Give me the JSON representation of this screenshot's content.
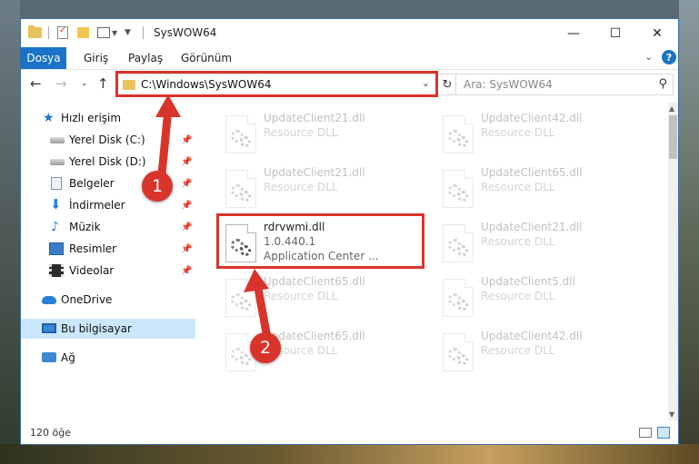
{
  "window": {
    "title": "SysWOW64",
    "controls": {
      "minimize": "—",
      "maximize": "☐",
      "close": "✕"
    }
  },
  "ribbon": {
    "tabs": [
      "Dosya",
      "Giriş",
      "Paylaş",
      "Görünüm"
    ],
    "active_tab": "Dosya",
    "expand_icon": "chevron-down-icon",
    "help": "?"
  },
  "address": {
    "path": "C:\\Windows\\SysWOW64",
    "search_placeholder": "Ara: SysWOW64"
  },
  "navigation": {
    "items": [
      {
        "label": "Hızlı erişim",
        "icon": "star-icon",
        "pinned": false
      },
      {
        "label": "Yerel Disk (C:)",
        "icon": "drive-icon",
        "pinned": true
      },
      {
        "label": "Yerel Disk (D:)",
        "icon": "drive-icon",
        "pinned": true
      },
      {
        "label": "Belgeler",
        "icon": "document-icon",
        "pinned": true
      },
      {
        "label": "İndirmeler",
        "icon": "download-icon",
        "pinned": true
      },
      {
        "label": "Müzik",
        "icon": "music-icon",
        "pinned": true
      },
      {
        "label": "Resimler",
        "icon": "pictures-icon",
        "pinned": true
      },
      {
        "label": "Videolar",
        "icon": "video-icon",
        "pinned": true
      },
      {
        "label": "OneDrive",
        "icon": "onedrive-icon",
        "pinned": false
      },
      {
        "label": "Bu bilgisayar",
        "icon": "computer-icon",
        "pinned": false,
        "selected": true
      },
      {
        "label": "Ağ",
        "icon": "network-icon",
        "pinned": false
      }
    ]
  },
  "files": {
    "col1": [
      {
        "name": "UpdateClient21.dll",
        "type": "Resource DLL"
      },
      {
        "name": "UpdateClient21.dll",
        "type": "Resource DLL"
      },
      {
        "name": "rdrvwmi.dll",
        "version": "1.0.440.1",
        "company": "Application Center ..."
      },
      {
        "name": "UpdateClient65.dll",
        "type": "Resource DLL"
      },
      {
        "name": "UpdateClient65.dll",
        "type": "Resource DLL"
      }
    ],
    "col2": [
      {
        "name": "UpdateClient42.dll",
        "type": "Resource DLL"
      },
      {
        "name": "UpdateClient65.dll",
        "type": "Resource DLL"
      },
      {
        "name": "UpdateClient21.dll",
        "type": "Resource DLL"
      },
      {
        "name": "UpdateClient5.dll",
        "type": "Resource DLL"
      },
      {
        "name": "UpdateClient42.dll",
        "type": "Resource DLL"
      }
    ]
  },
  "status": {
    "item_count": "120 öğe"
  },
  "callouts": [
    "1",
    "2"
  ],
  "colors": {
    "accent": "#1a73c8",
    "highlight": "#d9342b",
    "selection": "#cce8ff"
  }
}
